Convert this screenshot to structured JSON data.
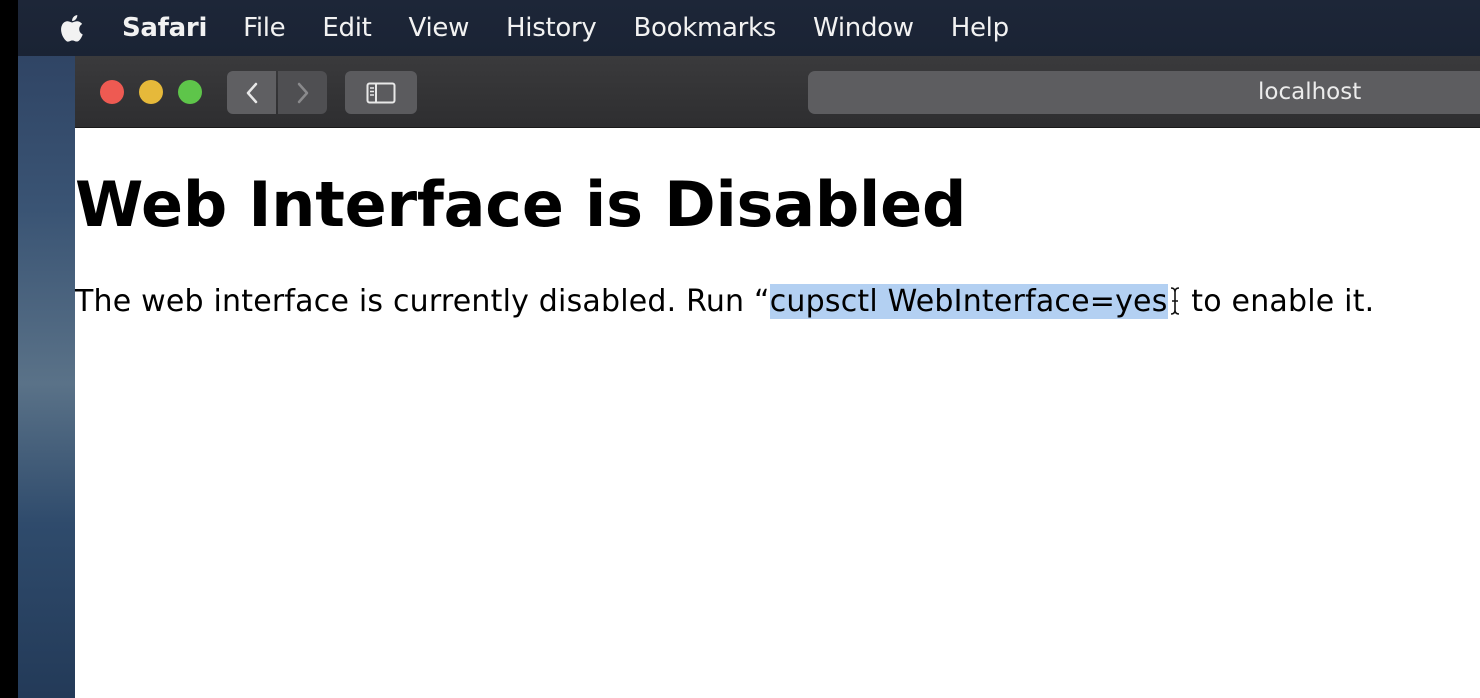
{
  "menubar": {
    "apple_icon": "apple-icon",
    "app_name": "Safari",
    "items": [
      "File",
      "Edit",
      "View",
      "History",
      "Bookmarks",
      "Window",
      "Help"
    ]
  },
  "toolbar": {
    "address": "localhost",
    "back_icon": "chevron-left-icon",
    "forward_icon": "chevron-right-icon",
    "sidebar_icon": "sidebar-icon"
  },
  "page": {
    "heading": "Web Interface is Disabled",
    "paragraph_before": "The web interface is currently disabled. Run “",
    "paragraph_selected": "cupsctl WebInterface=yes",
    "paragraph_after": " to enable it."
  },
  "colors": {
    "close": "#ee5a52",
    "minimize": "#e6b93a",
    "maximize": "#5ec54a",
    "selection": "#b3d0f2"
  }
}
